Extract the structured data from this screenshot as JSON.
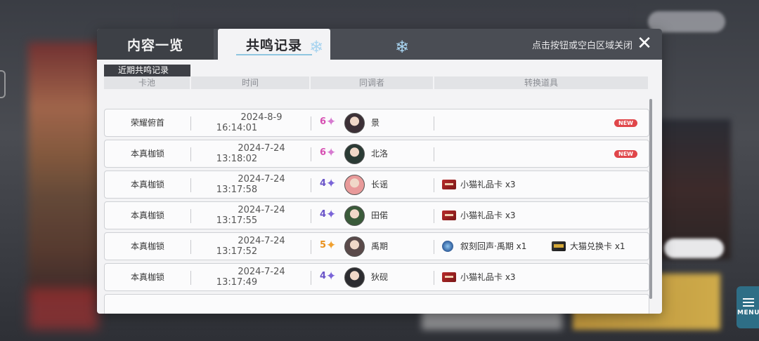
{
  "panel": {
    "tabs": [
      {
        "label": "内容一览"
      },
      {
        "label": "共鸣记录"
      }
    ],
    "close_hint": "点击按钮或空白区域关闭",
    "section_label": "近期共鸣记录",
    "columns": {
      "pool": "卡池",
      "time": "时间",
      "character": "同调者",
      "items": "转换道具"
    }
  },
  "records": [
    {
      "pool": "荣耀俯首",
      "date": "2024-8-9",
      "time": "16:14:01",
      "rarity": "6",
      "rarity_color": "#d64fb2",
      "star_color": "#d67ad0",
      "name": "景",
      "new": "NEW",
      "item1": "",
      "item2": ""
    },
    {
      "pool": "本真枷锁",
      "date": "2024-7-24",
      "time": "13:18:02",
      "rarity": "6",
      "rarity_color": "#d64fb2",
      "star_color": "#d67ad0",
      "name": "北洛",
      "new": "NEW",
      "item1": "",
      "item2": ""
    },
    {
      "pool": "本真枷锁",
      "date": "2024-7-24",
      "time": "13:17:58",
      "rarity": "4",
      "rarity_color": "#6a54c8",
      "star_color": "#7a64d8",
      "name": "长谣",
      "new": "",
      "item1": "小猫礼品卡 x3",
      "item2": ""
    },
    {
      "pool": "本真枷锁",
      "date": "2024-7-24",
      "time": "13:17:55",
      "rarity": "4",
      "rarity_color": "#6a54c8",
      "star_color": "#7a64d8",
      "name": "田偌",
      "new": "",
      "item1": "小猫礼品卡 x3",
      "item2": ""
    },
    {
      "pool": "本真枷锁",
      "date": "2024-7-24",
      "time": "13:17:52",
      "rarity": "5",
      "rarity_color": "#e8901c",
      "star_color": "#f0a030",
      "name": "禹期",
      "new": "",
      "item1": "叙刻回声·禹期 x1",
      "item2": "大猫兑换卡 x1"
    },
    {
      "pool": "本真枷锁",
      "date": "2024-7-24",
      "time": "13:17:49",
      "rarity": "4",
      "rarity_color": "#6a54c8",
      "star_color": "#7a64d8",
      "name": "狄砚",
      "new": "",
      "item1": "小猫礼品卡 x3",
      "item2": ""
    }
  ],
  "menu": {
    "label": "MENU"
  }
}
